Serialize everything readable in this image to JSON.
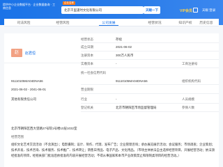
{
  "header": {
    "logo_text": "提供中小企业数据平台 · 企业数据查询 · 工商信息",
    "badge": "企业名称",
    "search_value": "北京千里逢时文化有限公司",
    "search_button": "天眼一下",
    "vip_label": "VIP会员",
    "login": "天眼 登录"
  },
  "nav": {
    "items": [
      "司法风险",
      "经营风险",
      "公司发展",
      "经营状况",
      "知识产权",
      "历史信息"
    ],
    "active_index": 2
  },
  "card": {
    "avatar_char": "赵",
    "person_name": "赵君恒",
    "rows": [
      {
        "label": "经营状态",
        "value": "存续"
      },
      {
        "label": "成立日期",
        "value": "2021-06-02"
      },
      {
        "label": "注册资本",
        "value": "300万人民币"
      },
      {
        "label": "实缴资本",
        "value": "-"
      },
      {
        "label": "统一社会信用代码",
        "value": "91110105MA04DNA56"
      },
      {
        "label": "营业期限",
        "value": "2021-06-02 至 2041-06-01"
      },
      {
        "label": "行业",
        "value": "-"
      },
      {
        "label": "登记机关",
        "value": "北京市朝阳区市场监督管理局"
      }
    ],
    "right_labels": [
      "工商注册号",
      "组织机构代码",
      "人员规模",
      "参保人数"
    ],
    "left_values": [
      "91110105MA04DNA56",
      "2021-06-02 - 2041-06-01",
      "其他有限责任公司"
    ],
    "address": "北京市朝阳区西大望路27号院1号楼10层1032室",
    "scope_label": "经营范围",
    "scope_text": "组织文化艺术交流活动（不含演出）；电影摄制；设计、制作、代理、发布广告；企业管理咨询；承办展览展示活动；会议服务；市场调查；企业策划；技术开发、技术咨询、技术服务、技术推广、技术转让；销售日用品、电子产品、文化用品。（市场主体依法自主选择经营项目，开展经营活动；依法须经批准的项目，经相关部门批准后依批准的内容开展经营活动；不得从事国家和本市产业政策禁止和限制类项目的经营活动。）"
  }
}
